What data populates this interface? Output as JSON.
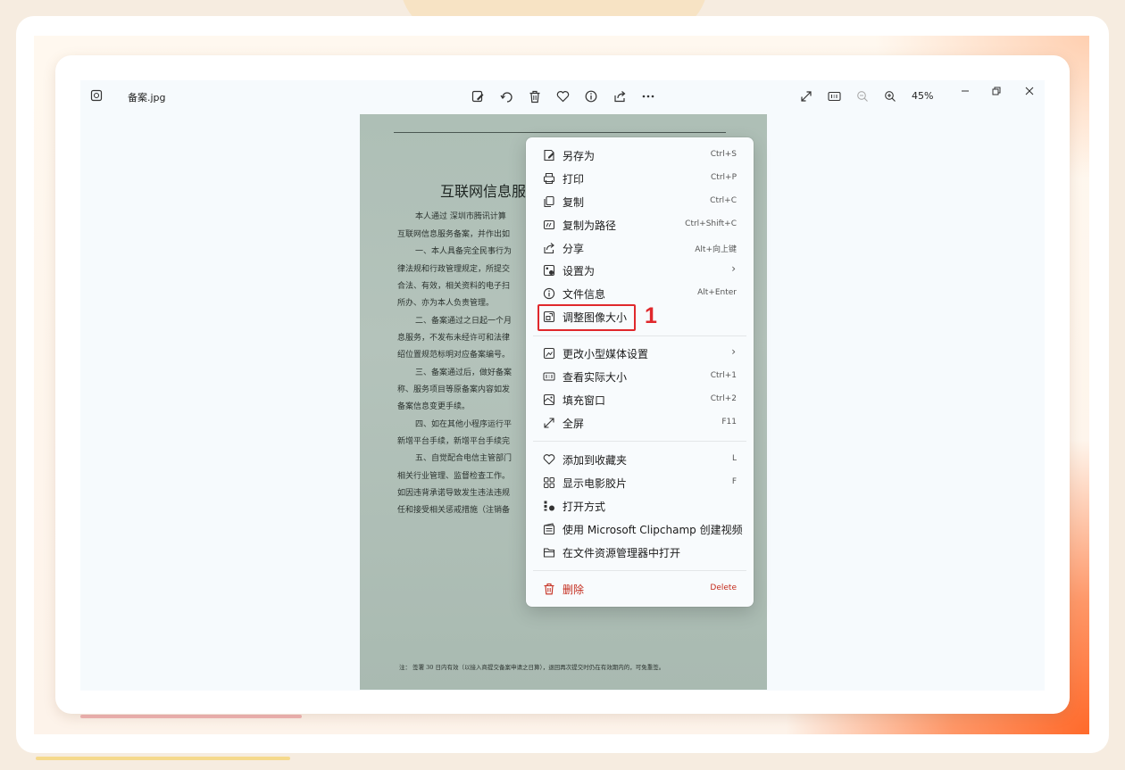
{
  "window": {
    "file_name": "备案.jpg",
    "zoom": "45%"
  },
  "toolbar": {
    "icons": [
      "edit-image-icon",
      "rotate-icon",
      "delete-icon",
      "favorite-icon",
      "info-icon",
      "share-icon",
      "more-icon"
    ],
    "right_icons": [
      "fullscreen-icon",
      "actual-size-icon",
      "zoom-out-icon",
      "zoom-in-icon"
    ],
    "window_controls": [
      "minimize-icon",
      "restore-icon",
      "close-icon"
    ]
  },
  "document": {
    "title": "互联网信息服",
    "lines": [
      "本人通过  深圳市腾讯计算",
      "互联网信息服务备案，并作出如",
      "一、本人具备完全民事行为",
      "律法规和行政管理规定，所提交",
      "合法、有效，相关资料的电子扫",
      "所办、亦为本人负责管理。",
      "二、备案通过之日起一个月",
      "息服务，不发布未经许可和法律",
      "绍位置规范标明对应备案编号。",
      "三、备案通过后，做好备案",
      "称、服务项目等原备案内容如发",
      "备案信息变更手续。",
      "四、如在其他小程序运行平",
      "新增平台手续，新增平台手续完",
      "五、自觉配合电信主管部门",
      "相关行业管理、监督检查工作。",
      "如因违背承诺导致发生违法违规",
      "任和接受相关惩戒措施（注销备"
    ],
    "footnote": "注：  签署 30 日内有效（以接入商提交备案申请之日算），退回再次提交时仍在有效期内的，可免重签。"
  },
  "context_menu": {
    "items": [
      {
        "label": "另存为",
        "shortcut": "Ctrl+S",
        "icon": "save-as-icon"
      },
      {
        "label": "打印",
        "shortcut": "Ctrl+P",
        "icon": "print-icon"
      },
      {
        "label": "复制",
        "shortcut": "Ctrl+C",
        "icon": "copy-icon"
      },
      {
        "label": "复制为路径",
        "shortcut": "Ctrl+Shift+C",
        "icon": "copy-path-icon"
      },
      {
        "label": "分享",
        "shortcut": "Alt+向上键",
        "icon": "share-icon"
      },
      {
        "label": "设置为",
        "shortcut": "",
        "icon": "set-as-icon",
        "arrow": "›"
      },
      {
        "label": "文件信息",
        "shortcut": "Alt+Enter",
        "icon": "info-icon"
      },
      {
        "label": "调整图像大小",
        "shortcut": "",
        "icon": "resize-image-icon"
      },
      {
        "label": "更改小型媒体设置",
        "shortcut": "",
        "icon": "media-settings-icon",
        "arrow": "›"
      },
      {
        "label": "查看实际大小",
        "shortcut": "Ctrl+1",
        "icon": "actual-size-icon"
      },
      {
        "label": "填充窗口",
        "shortcut": "Ctrl+2",
        "icon": "fill-window-icon"
      },
      {
        "label": "全屏",
        "shortcut": "F11",
        "icon": "fullscreen-icon"
      },
      {
        "label": "添加到收藏夹",
        "shortcut": "L",
        "icon": "favorite-icon"
      },
      {
        "label": "显示电影胶片",
        "shortcut": "F",
        "icon": "filmstrip-icon"
      },
      {
        "label": "打开方式",
        "shortcut": "",
        "icon": "open-with-icon"
      },
      {
        "label": "使用 Microsoft Clipchamp 创建视频",
        "shortcut": "",
        "icon": "clipchamp-icon"
      },
      {
        "label": "在文件资源管理器中打开",
        "shortcut": "",
        "icon": "folder-icon"
      },
      {
        "label": "删除",
        "shortcut": "Delete",
        "icon": "delete-icon"
      }
    ]
  },
  "annotation": {
    "step_number": "1",
    "highlight_color": "#e0282c"
  }
}
